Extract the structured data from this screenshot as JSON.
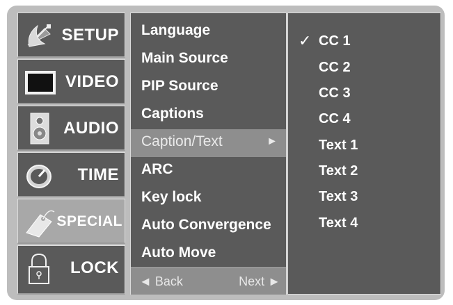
{
  "tabs": [
    {
      "label": "SETUP",
      "icon": "satellite-dish-icon"
    },
    {
      "label": "VIDEO",
      "icon": "monitor-icon"
    },
    {
      "label": "AUDIO",
      "icon": "speaker-icon"
    },
    {
      "label": "TIME",
      "icon": "clock-icon"
    },
    {
      "label": "SPECIAL",
      "icon": "tag-icon"
    },
    {
      "label": "LOCK",
      "icon": "padlock-icon"
    }
  ],
  "active_tab": "SPECIAL",
  "menu": {
    "items": [
      "Language",
      "Main Source",
      "PIP Source",
      "Captions",
      "Caption/Text",
      "ARC",
      "Key lock",
      "Auto Convergence",
      "Auto Move"
    ],
    "selected": "Caption/Text",
    "selected_arrow": "►",
    "back_label": "◄ Back",
    "next_label": "Next ►"
  },
  "submenu": {
    "items": [
      "CC 1",
      "CC 2",
      "CC 3",
      "CC 4",
      "Text 1",
      "Text 2",
      "Text 3",
      "Text 4"
    ],
    "checked": "CC 1",
    "check_mark": "✓"
  },
  "colors": {
    "panel": "#5a5a5a",
    "highlight": "#8e8e8e",
    "frame": "#bdbdbd"
  }
}
